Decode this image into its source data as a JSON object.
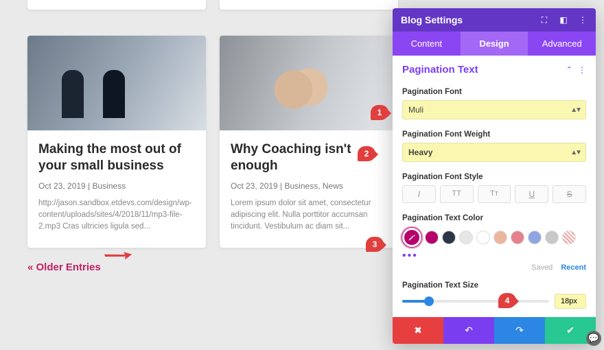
{
  "posts": [
    {
      "title": "Making the most out of your small business",
      "meta": "Oct 23, 2019 | Business",
      "excerpt": "http://jason.sandbox.etdevs.com/design/wp-content/uploads/sites/4/2018/11/mp3-file-2.mp3 Cras ultricies ligula sed..."
    },
    {
      "title": "Why Coaching isn't enough",
      "meta": "Oct 23, 2019 | Business, News",
      "excerpt": "Lorem ipsum dolor sit amet, consectetur adipiscing elit. Nulla porttitor accumsan tincidunt. Vestibulum ac diam sit..."
    }
  ],
  "pagination_link": "« Older Entries",
  "panel": {
    "title": "Blog Settings",
    "tabs": {
      "content": "Content",
      "design": "Design",
      "advanced": "Advanced"
    },
    "section_title": "Pagination Text",
    "labels": {
      "font": "Pagination Font",
      "weight": "Pagination Font Weight",
      "style": "Pagination Font Style",
      "color": "Pagination Text Color",
      "size": "Pagination Text Size"
    },
    "font_value": "Muli",
    "weight_value": "Heavy",
    "style_buttons": {
      "italic": "I",
      "upper": "TT",
      "smallcaps": "Tᴛ",
      "underline": "U",
      "strike": "S"
    },
    "color_swatches": [
      "#b6006b",
      "#2d3646",
      "#e6e6e6",
      "#ffffff",
      "#ecb69e",
      "#e4818d",
      "#8fa5e3",
      "#c8c8c8"
    ],
    "saved_label": "Saved",
    "recent_label": "Recent",
    "size_value": "18px"
  },
  "badges": {
    "b1": "1",
    "b2": "2",
    "b3": "3",
    "b4": "4"
  }
}
